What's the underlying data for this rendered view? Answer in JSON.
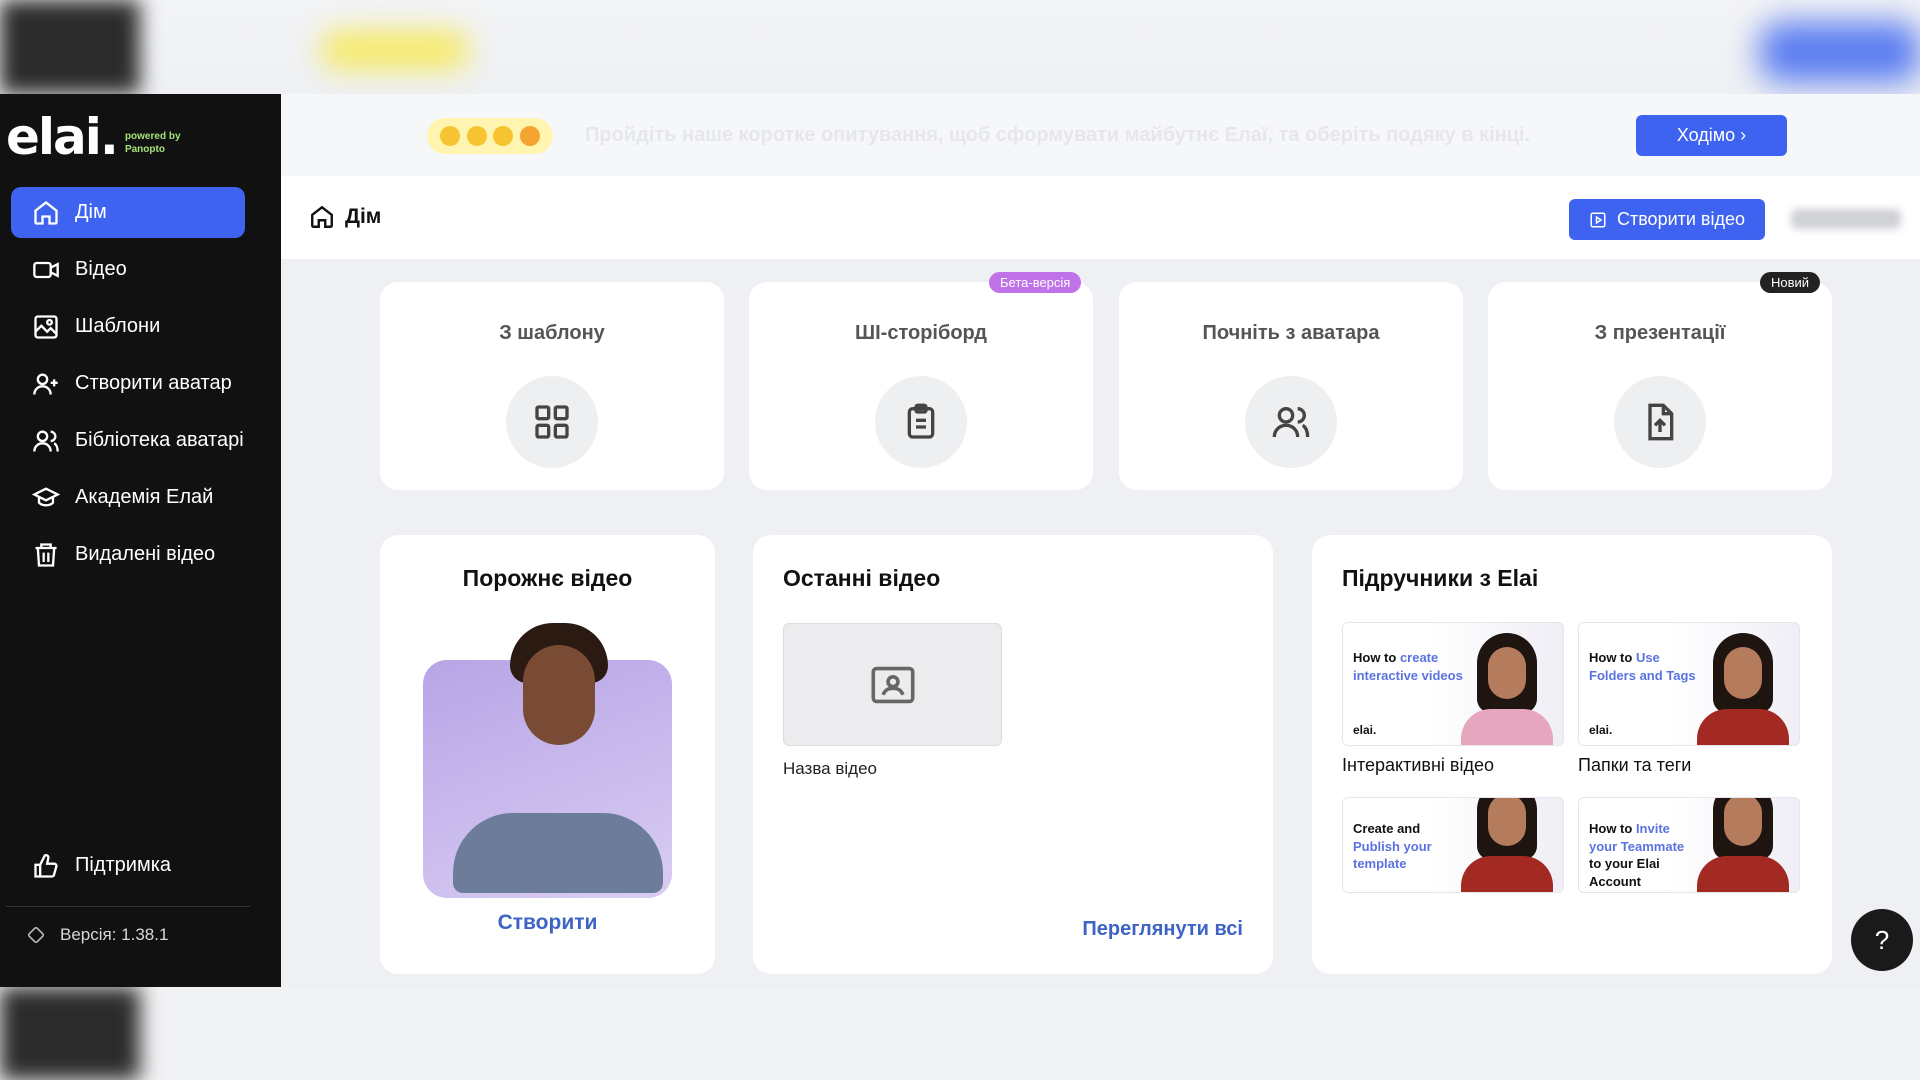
{
  "brand": {
    "logo": "elai.",
    "powered_line1": "powered by",
    "powered_line2": "Panopto"
  },
  "sidebar": {
    "items": [
      {
        "label": "Дім",
        "icon": "home-icon",
        "active": true
      },
      {
        "label": "Відео",
        "icon": "video-camera-icon"
      },
      {
        "label": "Шаблони",
        "icon": "templates-icon"
      },
      {
        "label": "Створити аватар",
        "icon": "add-user-icon"
      },
      {
        "label": "Бібліотека аватарів",
        "icon": "users-icon"
      },
      {
        "label": "Академія Елай",
        "icon": "graduation-cap-icon"
      },
      {
        "label": "Видалені відео",
        "icon": "trash-icon"
      }
    ],
    "support_label": "Підтримка",
    "version": "Версія: 1.38.1"
  },
  "survey": {
    "text": "Пройдіть наше коротке опитування, щоб сформувати майбутнє Елаї, та оберіть подяку в кінці.",
    "button": "Ходімо ›"
  },
  "header": {
    "title": "Дім",
    "create_button": "Створити відео"
  },
  "start_cards": [
    {
      "title": "З шаблону",
      "icon": "grid-icon"
    },
    {
      "title": "ШІ-сторіборд",
      "icon": "clipboard-icon",
      "badge": "Бета-версія"
    },
    {
      "title": "Почніть з аватара",
      "icon": "users-icon"
    },
    {
      "title": "З презентації",
      "icon": "file-upload-icon",
      "badge": "Новий"
    }
  ],
  "empty_video": {
    "title": "Порожнє відео",
    "action": "Створити"
  },
  "recent": {
    "title": "Останні відео",
    "video_name": "Назва відео",
    "view_all": "Переглянути всі"
  },
  "tutorials": {
    "title": "Підручники з Elai",
    "items": [
      {
        "pre": "How to ",
        "hl": "create interactive videos",
        "post": "",
        "label": "Інтерактивні відео",
        "brand": "elai."
      },
      {
        "pre": "How to ",
        "hl": "Use Folders and Tags",
        "post": "",
        "label": "Папки та теги",
        "brand": "elai."
      },
      {
        "pre": "Create and ",
        "hl": "Publish your template",
        "post": "",
        "label": "",
        "brand": ""
      },
      {
        "pre": "How to ",
        "hl": "Invite your Teammate",
        "post": " to your Elai Account",
        "label": "",
        "brand": ""
      }
    ]
  },
  "help_label": "?"
}
